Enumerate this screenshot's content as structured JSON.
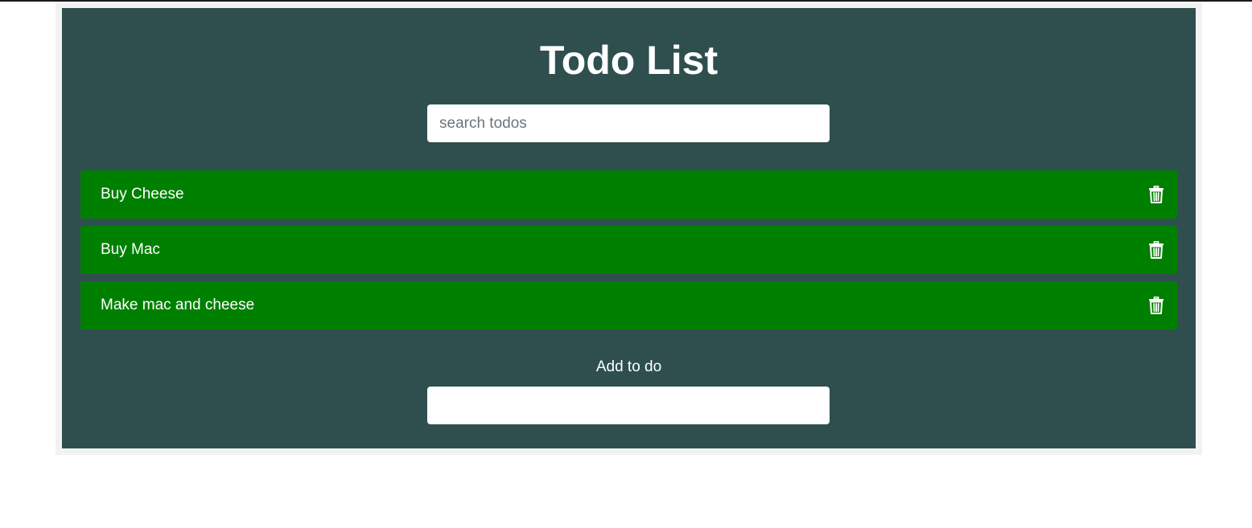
{
  "app": {
    "title": "Todo List",
    "background_color": "#2f4f4f",
    "item_color": "#008000"
  },
  "search": {
    "placeholder": "search todos",
    "value": ""
  },
  "todos": [
    {
      "text": "Buy Cheese",
      "action_icon": "trash-icon"
    },
    {
      "text": "Buy Mac",
      "action_icon": "trash-icon"
    },
    {
      "text": "Make mac and cheese",
      "action_icon": "trash-icon"
    }
  ],
  "add_form": {
    "label": "Add to do",
    "value": ""
  }
}
